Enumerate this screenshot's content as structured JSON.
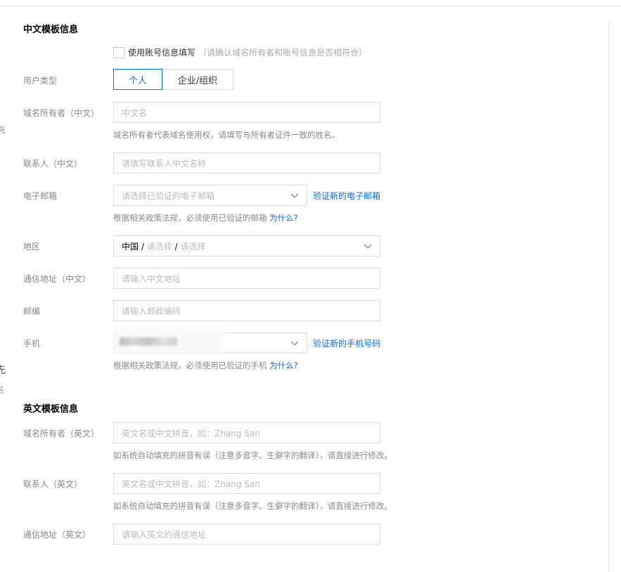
{
  "cn_section": {
    "title": "中文模板信息",
    "use_account_label": "使用账号信息填写",
    "use_account_note": "（请确认域名所有者和账号信息是否相符合）",
    "user_type_label": "用户类型",
    "user_type_options": [
      "个人",
      "企业/组织"
    ],
    "user_type_selected": "个人",
    "owner_label": "域名所有者（中文）",
    "owner_placeholder": "中文名",
    "owner_hint": "域名所有者代表域名使用权，请填写与所有者证件一致的姓名。",
    "contact_label": "联系人（中文）",
    "contact_placeholder": "请填写联系人中文名称",
    "email_label": "电子邮箱",
    "email_placeholder": "请选择已验证的电子邮箱",
    "email_verify_link": "验证新的电子邮箱",
    "email_hint": "根据相关政策法规，必须使用已验证的邮箱",
    "email_why": "为什么?",
    "region_label": "地区",
    "region_country": "中国",
    "region_province_placeholder": "请选择",
    "region_city_placeholder": "请选择",
    "address_label": "通信地址（中文）",
    "address_placeholder": "请输入中文地址",
    "zip_label": "邮编",
    "zip_placeholder": "请输入邮政编码",
    "phone_label": "手机",
    "phone_verify_link": "验证新的手机号码",
    "phone_hint": "根据相关政策法规，必须使用已验证的手机",
    "phone_why": "为什么?"
  },
  "en_section": {
    "title": "英文模板信息",
    "owner_label": "域名所有者（英文）",
    "owner_placeholder": "英文名或中文拼音，如：Zhang San",
    "owner_hint": "如系统自动填充的拼音有误（注意多音字、生僻字的翻译），请直接进行修改。",
    "contact_label": "联系人（英文）",
    "contact_placeholder": "英文名或中文拼音，如：Zhang San",
    "contact_hint": "如系统自动填充的拼音有误（注意多音字、生僻字的翻译），请直接进行修改。",
    "address_label": "通信地址（英文）",
    "address_placeholder": "请输入英文的通信地址"
  },
  "background_fragments": [
    "充",
    "先",
    "名"
  ],
  "colors": {
    "accent": "#006eff",
    "border": "#dcdcdc",
    "label": "#888888"
  }
}
